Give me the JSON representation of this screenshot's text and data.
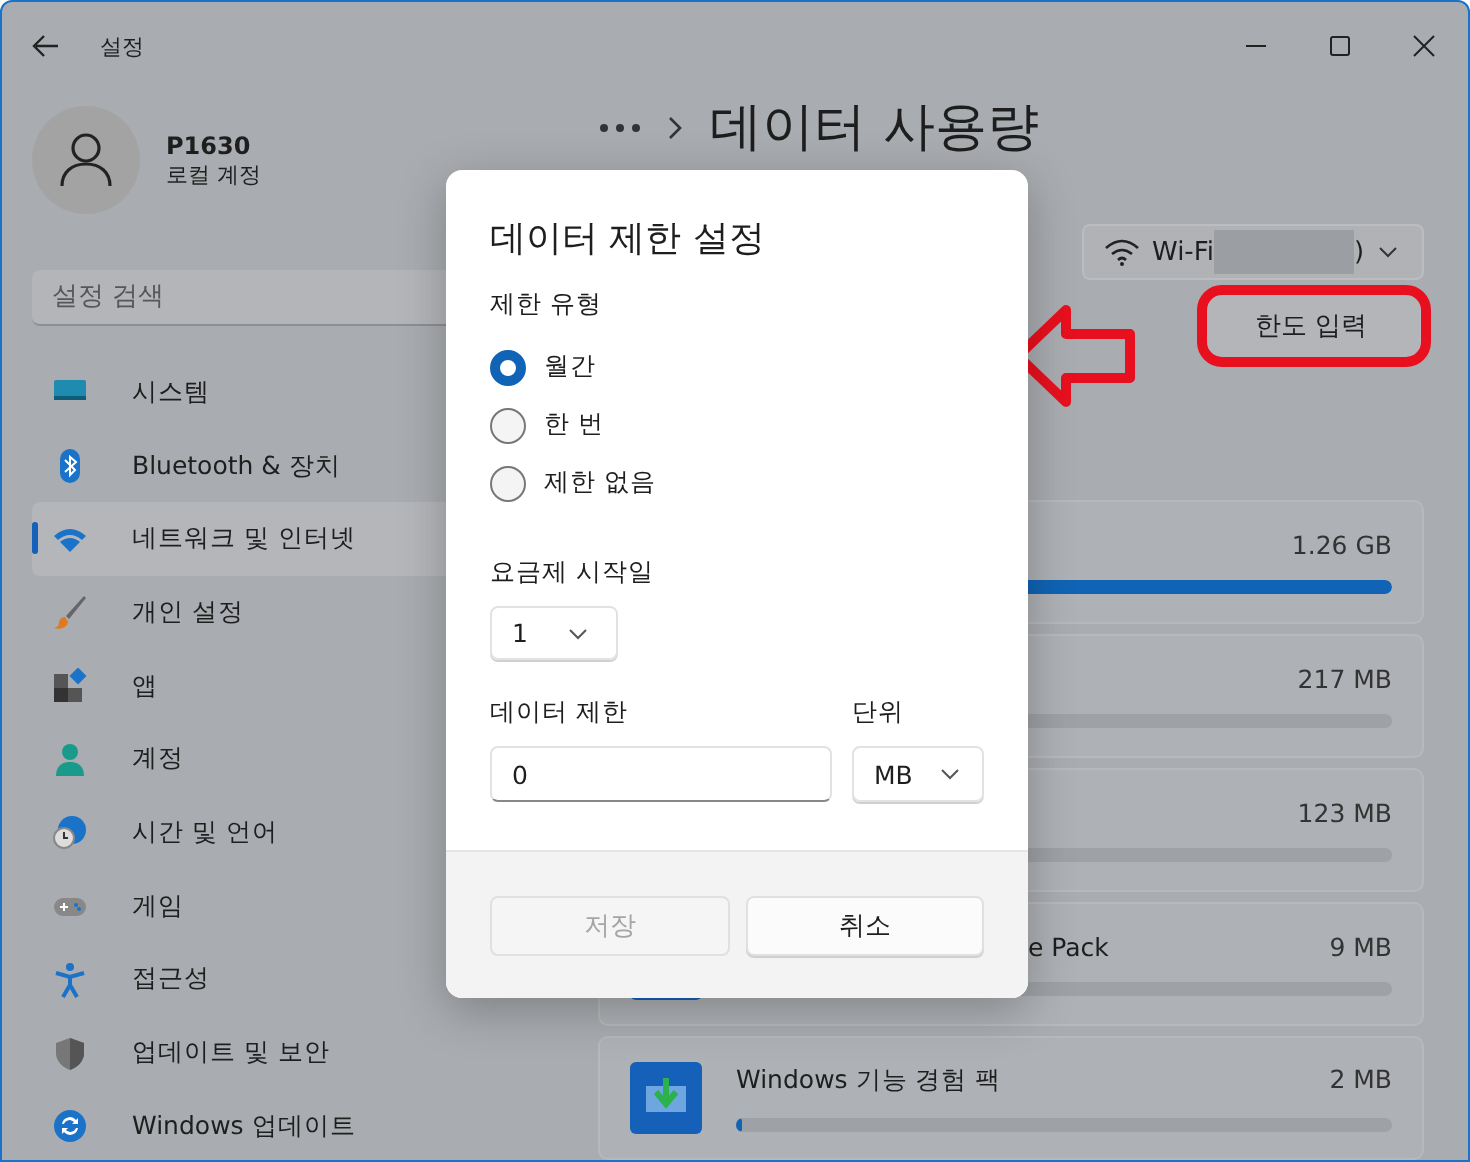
{
  "window": {
    "title": "설정"
  },
  "user": {
    "name": "P1630",
    "account": "로컬 계정"
  },
  "search": {
    "placeholder": "설정 검색"
  },
  "nav": [
    {
      "label": "시스템",
      "kind": "system",
      "selected": false
    },
    {
      "label": "Bluetooth & 장치",
      "kind": "bluetooth",
      "selected": false
    },
    {
      "label": "네트워크 및 인터넷",
      "kind": "network",
      "selected": true
    },
    {
      "label": "개인 설정",
      "kind": "brush",
      "selected": false
    },
    {
      "label": "앱",
      "kind": "apps",
      "selected": false
    },
    {
      "label": "계정",
      "kind": "account",
      "selected": false
    },
    {
      "label": "시간 및 언어",
      "kind": "time",
      "selected": false
    },
    {
      "label": "게임",
      "kind": "game",
      "selected": false
    },
    {
      "label": "접근성",
      "kind": "access",
      "selected": false
    },
    {
      "label": "업데이트 및 보안",
      "kind": "shield",
      "selected": false
    },
    {
      "label": "Windows 업데이트",
      "kind": "update",
      "selected": false
    }
  ],
  "page": {
    "title": "데이터 사용량"
  },
  "network": {
    "label": "Wi-Fi",
    "suffix": ")"
  },
  "limit_button": "한도 입력",
  "usage": [
    {
      "kind": "covered",
      "size": "1.26 GB",
      "level": 1
    },
    {
      "kind": "covered",
      "size": "217 MB",
      "level": 0.01
    },
    {
      "kind": "covered",
      "size": "123 MB",
      "level": 0.01
    },
    {
      "kind": "envelope",
      "name": "e Pack",
      "cut": true,
      "size": "9 MB",
      "level": 0.01
    },
    {
      "kind": "download",
      "name": "Windows 기능 경험 팩",
      "cut": false,
      "size": "2 MB",
      "level": 0.01
    }
  ],
  "dialog": {
    "title": "데이터 제한 설정",
    "type_label": "제한 유형",
    "options": [
      {
        "label": "월간",
        "selected": true
      },
      {
        "label": "한 번",
        "selected": false
      },
      {
        "label": "제한 없음",
        "selected": false
      }
    ],
    "start_label": "요금제 시작일",
    "start_value": "1",
    "limit_label": "데이터 제한",
    "limit_value": "0",
    "unit_label": "단위",
    "unit_value": "MB",
    "buttons": [
      {
        "label": "저장",
        "disabled": true
      },
      {
        "label": "취소",
        "disabled": false
      }
    ]
  }
}
